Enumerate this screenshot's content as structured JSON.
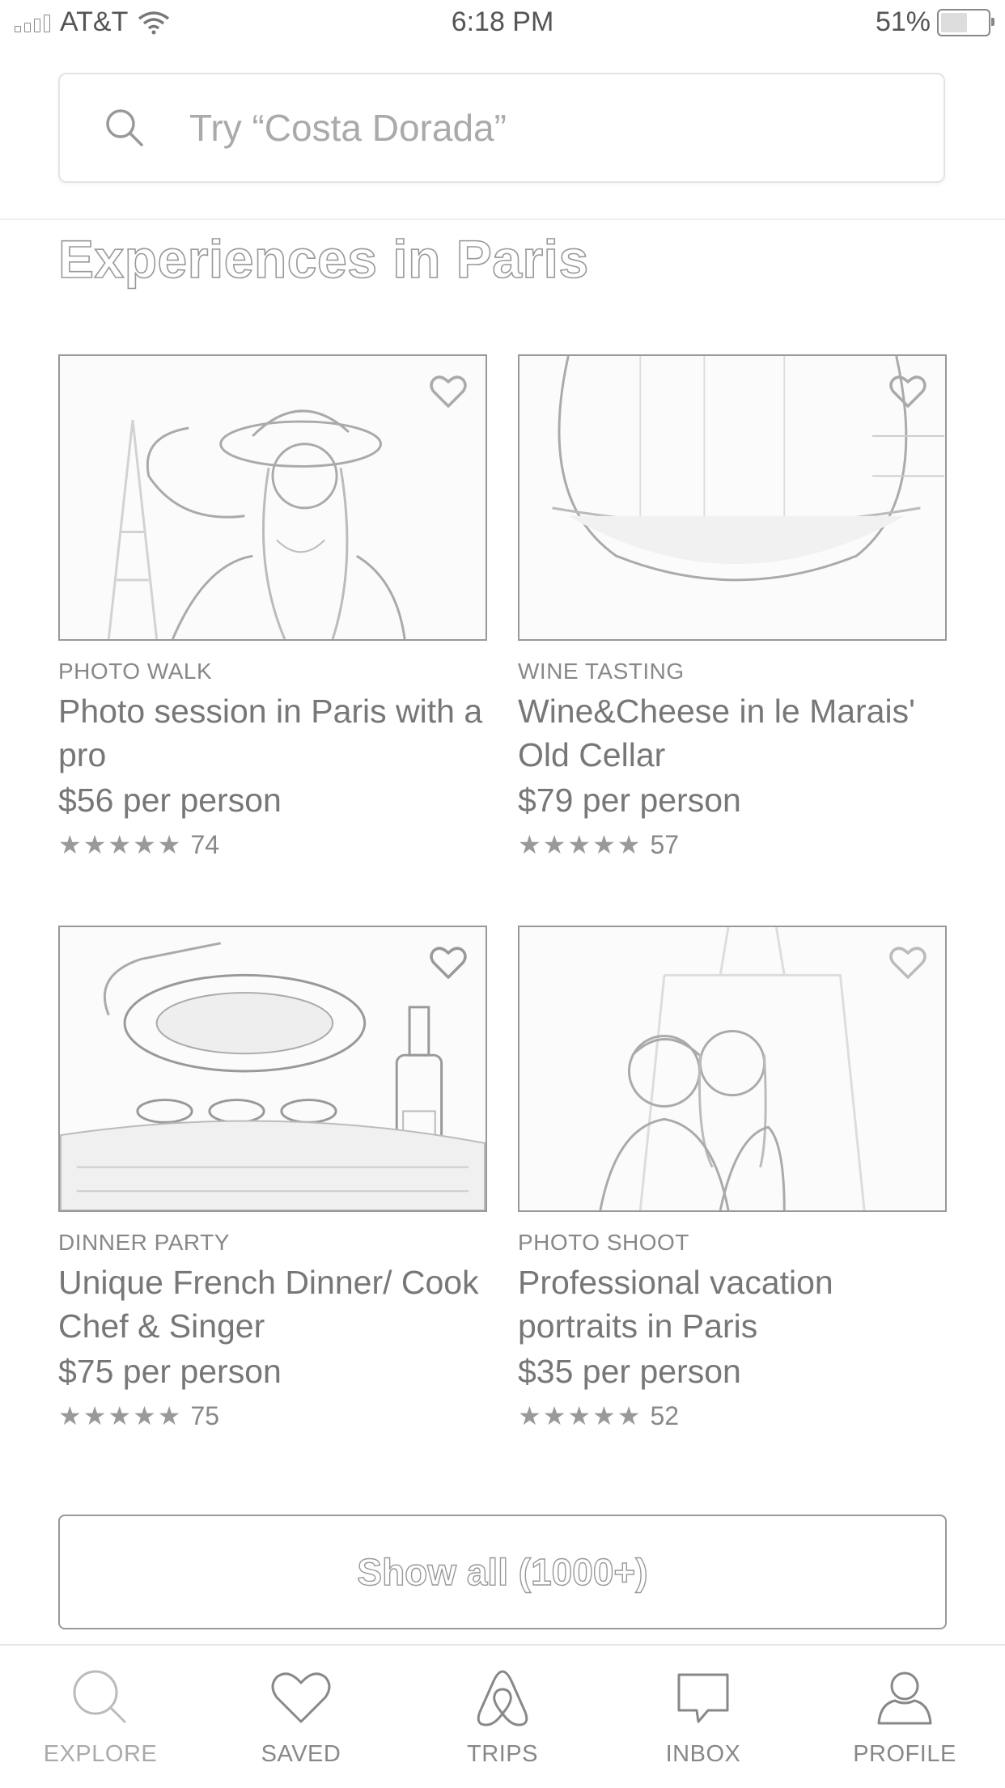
{
  "status_bar": {
    "carrier": "AT&T",
    "time": "6:18 PM",
    "battery": "51%"
  },
  "search": {
    "placeholder": "Try “Costa Dorada”"
  },
  "section_title": "Experiences in Paris",
  "cards": [
    {
      "category": "PHOTO WALK",
      "title": "Photo session in Paris with a pro",
      "price": "$56 per person",
      "stars": "★★★★★",
      "reviews": "74"
    },
    {
      "category": "WINE TASTING",
      "title": "Wine&Cheese in le Marais' Old Cellar",
      "price": "$79 per person",
      "stars": "★★★★★",
      "reviews": "57"
    },
    {
      "category": "DINNER PARTY",
      "title": "Unique French Dinner/ Cook Chef & Singer",
      "price": "$75 per person",
      "stars": "★★★★★",
      "reviews": "75"
    },
    {
      "category": "PHOTO SHOOT",
      "title": "Professional vacation portraits in Paris",
      "price": "$35 per person",
      "stars": "★★★★★",
      "reviews": "52"
    }
  ],
  "show_all_label": "Show all (1000+)",
  "tabs": [
    {
      "label": "EXPLORE",
      "icon": "search-icon"
    },
    {
      "label": "SAVED",
      "icon": "heart-icon"
    },
    {
      "label": "TRIPS",
      "icon": "airbnb-logo-icon"
    },
    {
      "label": "INBOX",
      "icon": "message-icon"
    },
    {
      "label": "PROFILE",
      "icon": "person-icon"
    }
  ]
}
